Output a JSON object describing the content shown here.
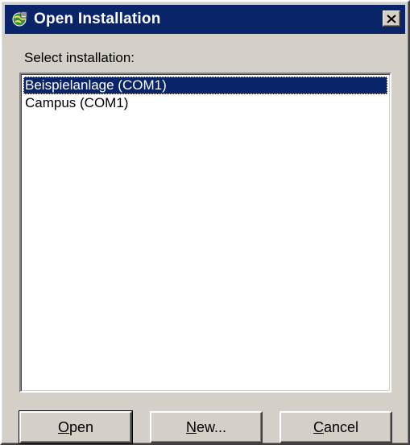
{
  "window": {
    "title": "Open Installation",
    "icon": "installation-globe-icon",
    "close_icon": "close-icon"
  },
  "label": {
    "select": "Select installation:"
  },
  "installations": [
    {
      "label": "Beispielanlage (COM1)",
      "selected": true
    },
    {
      "label": "Campus (COM1)",
      "selected": false
    }
  ],
  "buttons": {
    "open": {
      "mnemonic": "O",
      "rest": "pen"
    },
    "new": {
      "mnemonic": "N",
      "rest": "ew..."
    },
    "cancel": {
      "mnemonic": "C",
      "rest": "ancel"
    }
  },
  "colors": {
    "titlebar": "#0a246a",
    "face": "#d4d0c8",
    "selection": "#0a246a"
  }
}
